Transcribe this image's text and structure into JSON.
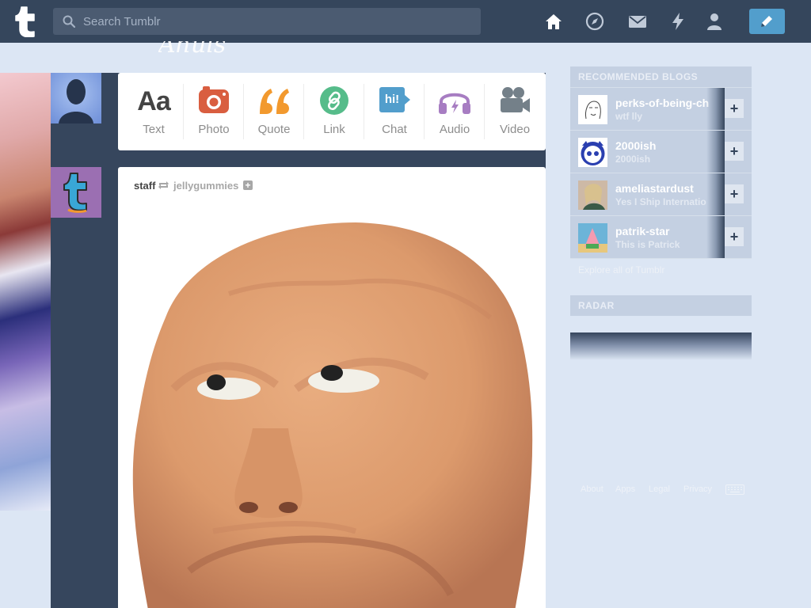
{
  "topbar": {
    "logo_icon": "tumblr-logo",
    "search": {
      "placeholder": "Search Tumblr",
      "value": ""
    },
    "nav_icons": [
      "home-icon",
      "explore-icon",
      "inbox-icon",
      "activity-icon",
      "account-icon"
    ],
    "compose_icon": "pencil-icon",
    "accent": "#529ecc",
    "bar_color": "#35465c"
  },
  "composer": {
    "post_types": [
      {
        "label": "Text",
        "icon": "text-icon",
        "glyph": "Aa",
        "color": "#444444"
      },
      {
        "label": "Photo",
        "icon": "camera-icon",
        "color": "#d95e40"
      },
      {
        "label": "Quote",
        "icon": "quote-icon",
        "glyph": "❝",
        "color": "#f2992e"
      },
      {
        "label": "Link",
        "icon": "link-icon",
        "color": "#56bc8a"
      },
      {
        "label": "Chat",
        "icon": "chat-icon",
        "glyph": "hi!",
        "color": "#529ecc"
      },
      {
        "label": "Audio",
        "icon": "headphones-icon",
        "color": "#a77dc2"
      },
      {
        "label": "Video",
        "icon": "video-camera-icon",
        "color": "#748089"
      }
    ]
  },
  "post": {
    "author": "staff",
    "reblogged_from": "jellygummies",
    "reblog_icon": "reblog-icon"
  },
  "sidebar": {
    "recommended_title": "RECOMMENDED BLOGS",
    "blogs": [
      {
        "name": "perks-of-being-ch",
        "subtitle": "wtf lly"
      },
      {
        "name": "2000ish",
        "subtitle": "2000ish"
      },
      {
        "name": "ameliastardust",
        "subtitle": "Yes I Ship Internatio"
      },
      {
        "name": "patrik-star",
        "subtitle": "This is Patrick"
      }
    ],
    "explore_link": "Explore all of Tumblr",
    "radar_title": "RADAR"
  },
  "footer": {
    "links": [
      "About",
      "Apps",
      "Legal",
      "Privacy"
    ],
    "keyboard_icon": "keyboard-icon"
  }
}
